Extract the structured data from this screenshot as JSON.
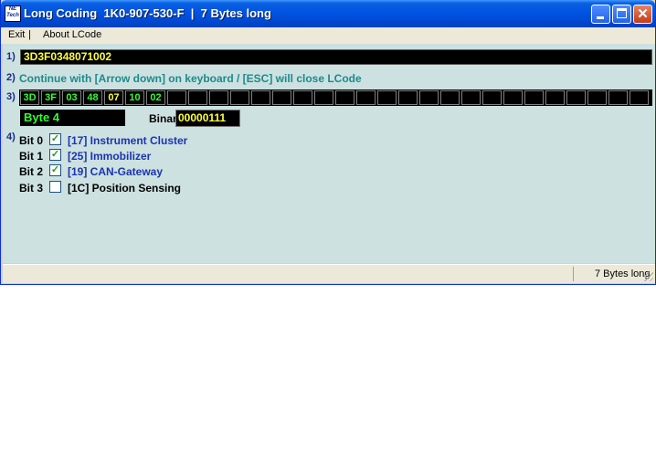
{
  "window": {
    "title": "Long Coding  1K0-907-530-F  |  7 Bytes long",
    "app_icon_text": "NE Tech"
  },
  "menu": {
    "items": [
      "Exit",
      "About LCode"
    ],
    "separator": "|"
  },
  "section_numbers": [
    "1)",
    "2)",
    "3)",
    "4)"
  ],
  "coding": {
    "value": "3D3F0348071002"
  },
  "instruction": "Continue with [Arrow down] on keyboard / [ESC] will close LCode",
  "bytes": {
    "values": [
      "3D",
      "3F",
      "03",
      "48",
      "07",
      "10",
      "02"
    ],
    "selected_index": 4,
    "total_cells": 30
  },
  "byte_info": {
    "label": "Byte 4",
    "binary_label": "Binary:",
    "binary_value": "00000111"
  },
  "bits": [
    {
      "name": "Bit 0",
      "checked": true,
      "label": "[17] Instrument Cluster"
    },
    {
      "name": "Bit 1",
      "checked": true,
      "label": "[25] Immobilizer"
    },
    {
      "name": "Bit 2",
      "checked": true,
      "label": "[19] CAN-Gateway"
    },
    {
      "name": "Bit 3",
      "checked": false,
      "label": "[1C] Position Sensing"
    }
  ],
  "status": {
    "text": "7 Bytes long"
  },
  "colors": {
    "title_blue": "#0054e3",
    "client_bg": "#cde1e1",
    "byte_green": "#30ff30",
    "code_yellow": "#ffff40",
    "instruction_teal": "#1d8a8a"
  }
}
